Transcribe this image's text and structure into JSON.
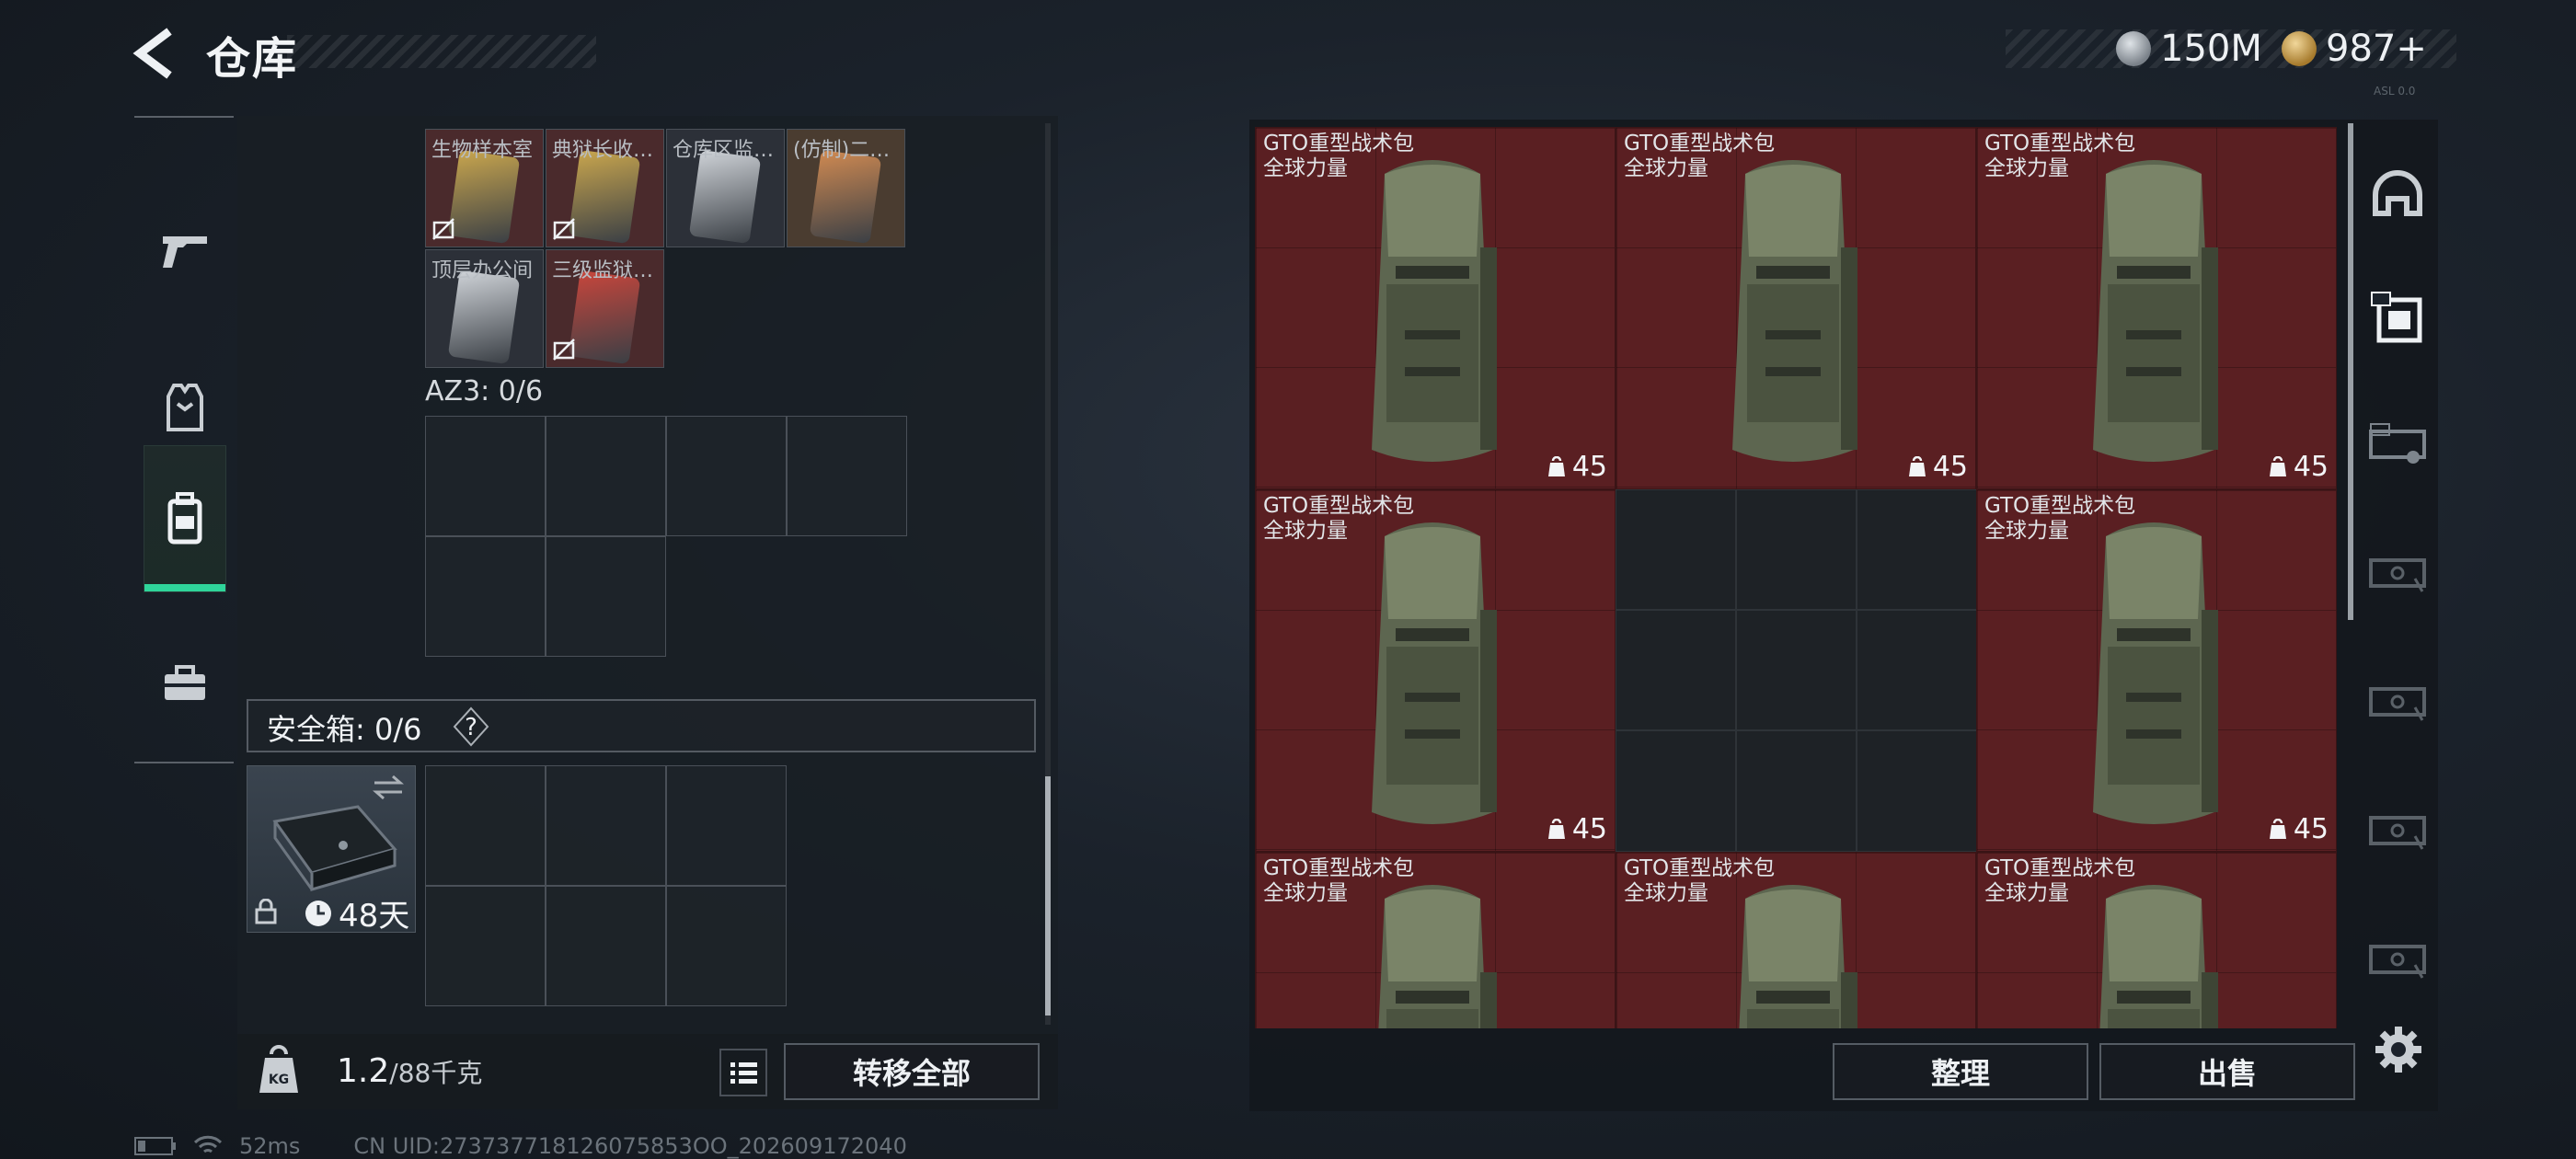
{
  "header": {
    "title": "仓库",
    "currencies": [
      {
        "icon": "silver-coin-icon",
        "value": "150M"
      },
      {
        "icon": "gold-coin-icon",
        "value": "987+"
      }
    ],
    "build_tag": "ASL 0.0"
  },
  "left_nav": {
    "items": [
      {
        "icon": "gun-icon",
        "active": false
      },
      {
        "icon": "armor-vest-icon",
        "active": false
      },
      {
        "icon": "backpack-icon",
        "active": true
      },
      {
        "icon": "toolbox-icon",
        "active": false
      }
    ],
    "accent_color": "#2fd59a"
  },
  "container": {
    "keycards": [
      {
        "label": "生物样本室",
        "color": "#c9a64e"
      },
      {
        "label": "典狱长收…",
        "color": "#c9a64e"
      },
      {
        "label": "仓库区监…",
        "color": "#cfd3d8"
      },
      {
        "label": "(仿制)二…",
        "color": "#d08a52"
      },
      {
        "label": "顶层办公间",
        "color": "#cfd3d8"
      },
      {
        "label": "三级监狱…",
        "color": "#c8463c"
      }
    ],
    "az3_label": "AZ3: 0/6",
    "safebox": {
      "label": "安全箱: 0/6",
      "help": "?",
      "days": "48天"
    }
  },
  "bottom_bar": {
    "weight_current": "1.2",
    "weight_total": "/88千克",
    "weight_icon_label": "KG",
    "transfer_all": "转移全部"
  },
  "status_bar": {
    "ping": "52ms",
    "uid": "CN UID:273737718126075853OO_202609172040"
  },
  "stash": {
    "items": [
      {
        "name": "GTO重型战术包",
        "sub": "全球力量",
        "count": "45"
      },
      {
        "name": "GTO重型战术包",
        "sub": "全球力量",
        "count": "45"
      },
      {
        "name": "GTO重型战术包",
        "sub": "全球力量",
        "count": "45"
      },
      {
        "name": "GTO重型战术包",
        "sub": "全球力量",
        "count": "45"
      },
      {
        "name": "GTO重型战术包",
        "sub": "全球力量",
        "count": "45"
      },
      {
        "name": "GTO重型战术包",
        "sub": "全球力量",
        "count": ""
      },
      {
        "name": "GTO重型战术包",
        "sub": "全球力量",
        "count": ""
      },
      {
        "name": "GTO重型战术包",
        "sub": "全球力量",
        "count": ""
      }
    ],
    "item_bg_color": "#5a1f22",
    "sort_label": "整理",
    "sell_label": "出售",
    "right_tabs": [
      "helmet-icon",
      "case-gti-icon",
      "case-gti-2-icon",
      "case-locked-icon",
      "case-locked-icon",
      "case-locked-icon",
      "case-locked-icon"
    ]
  }
}
